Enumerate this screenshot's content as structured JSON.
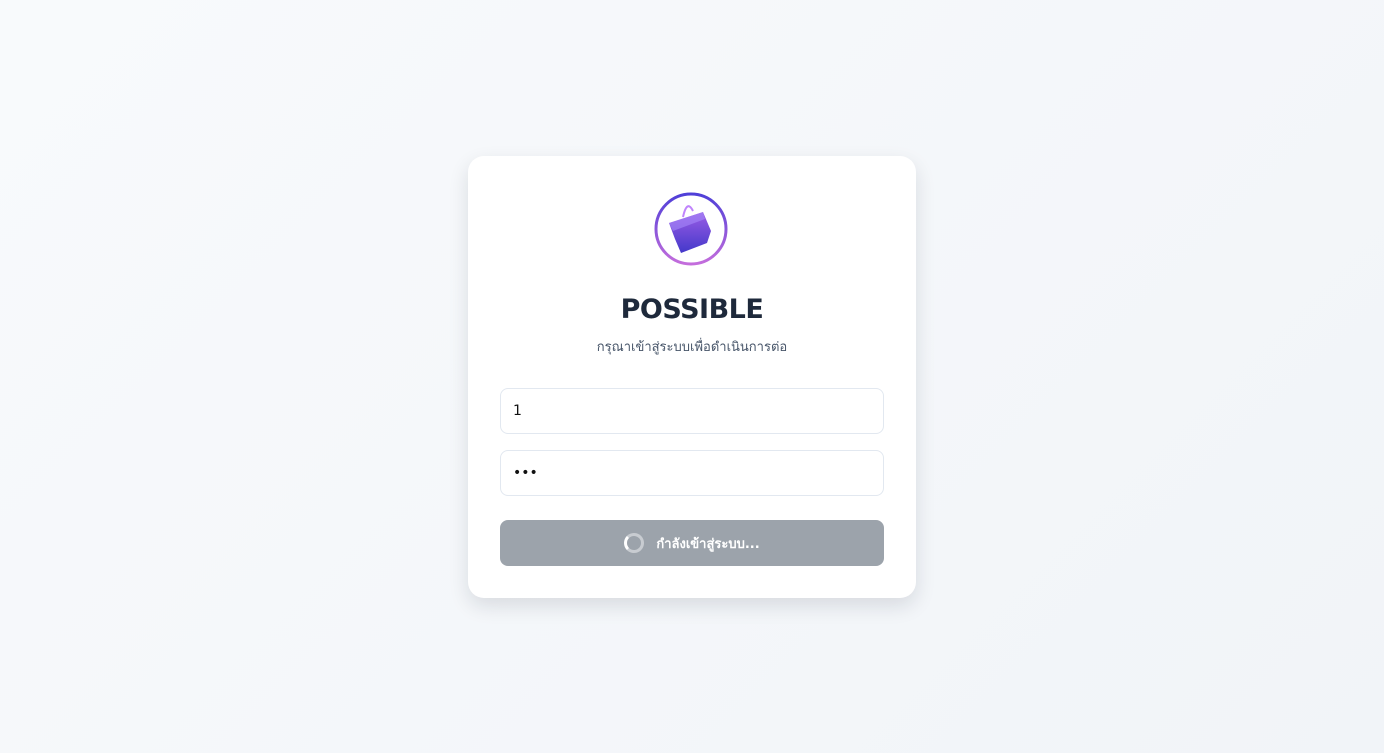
{
  "app": {
    "title": "POSSIBLE",
    "subtitle": "กรุณาเข้าสู่ระบบเพื่อดำเนินการต่อ"
  },
  "form": {
    "username_value": "1",
    "password_value": "abc",
    "submit_label": "กำลังเข้าสู่ระบบ...",
    "submit_state": "loading"
  },
  "colors": {
    "button_disabled": "#9ca3ab",
    "title": "#1e293b",
    "logo_ring_start": "#4f46e5",
    "logo_ring_end": "#c06ad8"
  }
}
